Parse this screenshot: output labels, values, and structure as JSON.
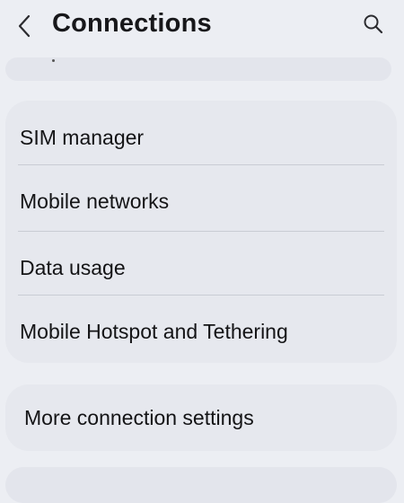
{
  "header": {
    "title": "Connections",
    "back_icon": "chevron-left-icon",
    "search_icon": "search-icon"
  },
  "items": [
    {
      "label": "SIM manager"
    },
    {
      "label": "Mobile networks"
    },
    {
      "label": "Data usage"
    },
    {
      "label": "Mobile Hotspot and Tethering"
    }
  ],
  "more": {
    "label": "More connection settings"
  },
  "colors": {
    "background": "#eceef3",
    "card": "#e6e8ee",
    "text": "#141416",
    "divider": "#c9ccd4"
  }
}
